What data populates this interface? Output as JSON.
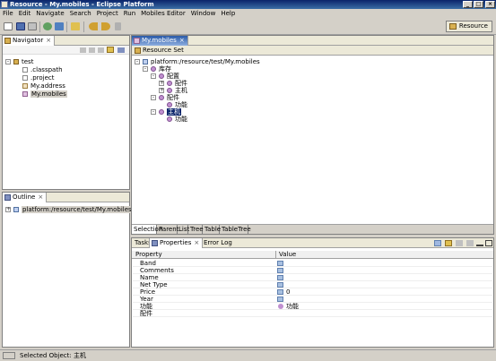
{
  "window": {
    "title": "Resource - My.mobiles - Eclipse Platform"
  },
  "menu": [
    "File",
    "Edit",
    "Navigate",
    "Search",
    "Project",
    "Run",
    "Mobiles Editor",
    "Window",
    "Help"
  ],
  "perspective": {
    "label": "Resource"
  },
  "navigator": {
    "tab_label": "Navigator",
    "items": [
      {
        "label": "test",
        "icon": "folder-icon",
        "expanded": true
      },
      {
        "label": ".classpath",
        "icon": "file-icon"
      },
      {
        "label": ".project",
        "icon": "file-icon"
      },
      {
        "label": "My.address",
        "icon": "file-icon"
      },
      {
        "label": "My.mobiles",
        "icon": "file-icon",
        "selected": true
      }
    ]
  },
  "outline": {
    "tab_label": "Outline",
    "item": "platform:/resource/test/My.mobiles"
  },
  "editor": {
    "tab_label": "My.mobiles",
    "header": "Resource Set",
    "tree": [
      {
        "label": "platform:/resource/test/My.mobiles",
        "level": 0,
        "toggle": "-"
      },
      {
        "label": "库存",
        "level": 1,
        "toggle": "-"
      },
      {
        "label": "配置",
        "level": 2,
        "toggle": "-"
      },
      {
        "label": "配件",
        "level": 3,
        "toggle": "+"
      },
      {
        "label": "主机",
        "level": 3,
        "toggle": "+"
      },
      {
        "label": "配件",
        "level": 2,
        "toggle": "-"
      },
      {
        "label": "功能",
        "level": 3,
        "toggle": ""
      },
      {
        "label": "主机",
        "level": 2,
        "toggle": "-",
        "selected": true
      },
      {
        "label": "功能",
        "level": 3,
        "toggle": ""
      }
    ],
    "bottom_tabs": [
      "Selection",
      "Parent",
      "List",
      "Tree",
      "Table",
      "TableTree"
    ]
  },
  "properties": {
    "tabs": [
      "Tasks",
      "Properties",
      "Error Log"
    ],
    "columns": [
      "Property",
      "Value"
    ],
    "rows": [
      {
        "name": "Band",
        "value": ""
      },
      {
        "name": "Comments",
        "value": ""
      },
      {
        "name": "Name",
        "value": ""
      },
      {
        "name": "Net Type",
        "value": ""
      },
      {
        "name": "Price",
        "value": "0"
      },
      {
        "name": "Year",
        "value": ""
      },
      {
        "name": "功能",
        "value": "功能"
      },
      {
        "name": "配件",
        "value": ""
      }
    ]
  },
  "status": {
    "text": "Selected Object: 主机"
  },
  "colors": {
    "title_bar": "#0a246a",
    "active_tab": "#2a5aa8",
    "selection": "#0a246a",
    "background": "#d4d0c8"
  }
}
